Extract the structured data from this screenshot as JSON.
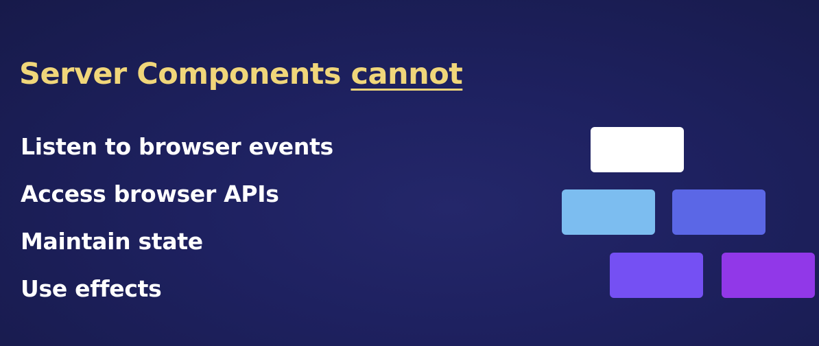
{
  "slide": {
    "title_main": "Server Components",
    "title_emphasis": "cannot",
    "items": [
      "Listen to browser events",
      "Access browser APIs",
      "Maintain state",
      "Use effects"
    ]
  },
  "component_tree": {
    "nodes": [
      {
        "id": "root",
        "color": "#ffffff"
      },
      {
        "id": "child-left",
        "color": "#7cbdf0"
      },
      {
        "id": "child-right",
        "color": "#5b67e6"
      },
      {
        "id": "grandchild-left",
        "color": "#7550f3"
      },
      {
        "id": "grandchild-right",
        "color": "#9138e8"
      }
    ]
  },
  "colors": {
    "title": "#f0d67a",
    "text": "#ffffff",
    "background": "#1e2160"
  }
}
